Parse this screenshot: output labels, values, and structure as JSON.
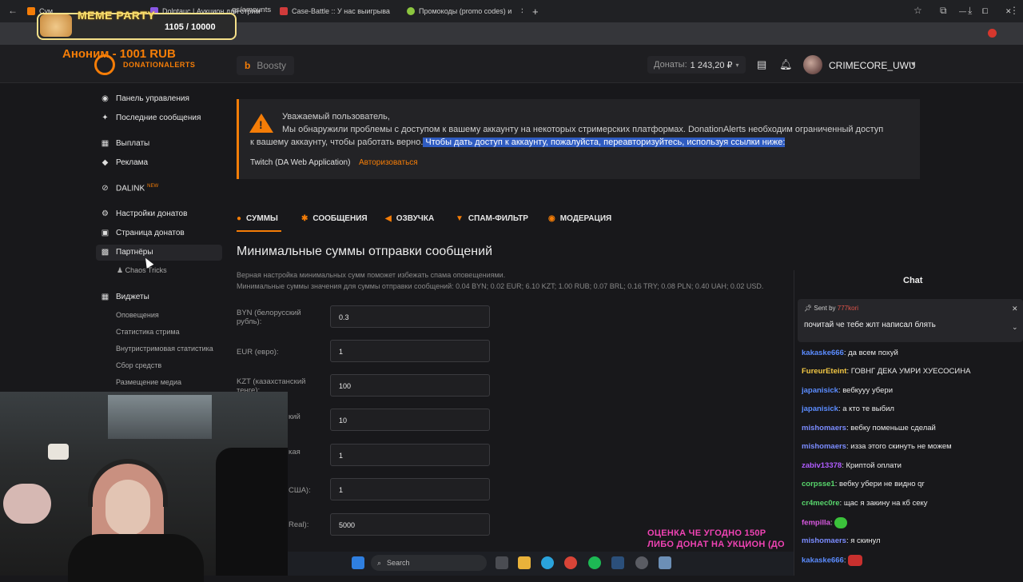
{
  "browser": {
    "tabs": [
      {
        "label": "Сум"
      },
      {
        "label": "Dolntauc | Аукцион для стрим"
      },
      {
        "label": "Case-Battle :: У нас выигрыва"
      },
      {
        "label": "Промокоды (promo codes) и"
      }
    ],
    "new_tab": "+",
    "url": "gs/amounts",
    "window_controls": {
      "minimize": "—",
      "maximize": "⧠",
      "close": "✕"
    }
  },
  "overlay": {
    "title": "MEME PARTY",
    "counter": "1105 / 10000"
  },
  "header": {
    "anon_label": "Аноним - 1001 RUB",
    "brand": "DONATIONALERTS",
    "boosty": "Boosty",
    "boosty_letter": "b",
    "donations_label": "Донаты:",
    "donations_value": "1 243,20 ₽",
    "username": "CRIMECORE_UWU"
  },
  "sidebar": {
    "items": [
      {
        "label": "Панель управления",
        "icon": "dashboard-icon"
      },
      {
        "label": "Последние сообщения",
        "icon": "messages-icon"
      },
      {
        "label": "Выплаты",
        "icon": "payouts-icon"
      },
      {
        "label": "Реклама",
        "icon": "ads-icon"
      },
      {
        "label": "DALINK",
        "icon": "dalink-icon",
        "badge": "NEW"
      },
      {
        "label": "Настройки донатов",
        "icon": "settings-icon"
      },
      {
        "label": "Страница донатов",
        "icon": "page-icon"
      },
      {
        "label": "Партнёры",
        "icon": "partners-icon"
      },
      {
        "label": "Виджеты",
        "icon": "widgets-icon"
      }
    ],
    "partner_sub": "Chaos Tricks",
    "widget_subs": [
      "Оповещения",
      "Статистика стрима",
      "Внутристримовая статистика",
      "Сбор средств",
      "Размещение медиа"
    ]
  },
  "alert": {
    "line1": "Уважаемый пользователь,",
    "line2": "Мы обнаружили проблемы с доступом к вашему аккаунту на некоторых стримерских платформах. DonationAlerts необходим ограниченный доступ",
    "line3a": "к вашему аккаунту, чтобы работать верно.",
    "line3b": " Чтобы дать доступ к аккаунту, пожалуйста, переавторизуйтесь, используя ссылки ниже:",
    "platform": "Twitch (DA Web Application)",
    "auth_link": "Авторизоваться"
  },
  "tabs": [
    {
      "label": "СУММЫ",
      "icon": "coin-icon"
    },
    {
      "label": "СООБЩЕНИЯ",
      "icon": "message-icon"
    },
    {
      "label": "ОЗВУЧКА",
      "icon": "speaker-icon"
    },
    {
      "label": "СПАМ-ФИЛЬТР",
      "icon": "filter-icon"
    },
    {
      "label": "МОДЕРАЦИЯ",
      "icon": "moderation-icon"
    }
  ],
  "main": {
    "heading": "Минимальные суммы отправки сообщений",
    "desc1": "Верная настройка минимальных сумм поможет избежать спама оповещениями.",
    "desc2": "Минимальные суммы значения для суммы отправки сообщений: 0.04 BYN; 0.02 EUR; 6.10 KZT; 1.00 RUB; 0.07 BRL; 0.16 TRY; 0.08 PLN; 0.40 UAH; 0.02 USD.",
    "fields": [
      {
        "label": "BYN (белорусский рубль):",
        "value": "0.3"
      },
      {
        "label": "EUR (евро):",
        "value": "1"
      },
      {
        "label": "KZT (казахстанский тенге):",
        "value": "100"
      },
      {
        "label": "кий",
        "value": "10"
      },
      {
        "label": "кая",
        "value": "1"
      },
      {
        "label": "США):",
        "value": "1"
      },
      {
        "label": "Real):",
        "value": "5000"
      }
    ]
  },
  "chat": {
    "title": "Chat",
    "pinned_sent_by": "Sent by",
    "pinned_user": "777kori",
    "pinned_msg": "почитай че тебе жлт написал блять",
    "messages": [
      {
        "user": "kakaske666",
        "color": "#5b8cff",
        "text": ": да всем похуй"
      },
      {
        "user": "FureurEteint",
        "color": "#f2c744",
        "text": ": ГОВНГ ДЕКА УМРИ ХУЕСОСИНА"
      },
      {
        "user": "japanisick",
        "color": "#5b8cff",
        "text": ": вебкууу убери"
      },
      {
        "user": "japanisick",
        "color": "#5b8cff",
        "text": ": а кто те выбил"
      },
      {
        "user": "mishomaers",
        "color": "#7b8cff",
        "text": ": вебку поменьше сделай"
      },
      {
        "user": "mishomaers",
        "color": "#7b8cff",
        "text": ": изза этого скинуть не можем"
      },
      {
        "user": "zabiv13378",
        "color": "#b05cff",
        "text": ": Криптой оплати"
      },
      {
        "user": "corpsse1",
        "color": "#58d66c",
        "text": ": вебку убери не видно qr"
      },
      {
        "user": "cr4mec0re",
        "color": "#58d66c",
        "text": ": щас я закину на кб секу"
      },
      {
        "user": "fempilla",
        "color": "#d858e0",
        "text": ": "
      },
      {
        "user": "mishomaers",
        "color": "#7b8cff",
        "text": ": я скинул"
      },
      {
        "user": "kakaske666",
        "color": "#5b8cff",
        "text": ": "
      }
    ]
  },
  "stream_overlay": {
    "line1": "ОЦЕНКА ЧЕ УГОДНО 150Р",
    "line2": "ЛИБО ДОНАТ НА УКЦИОН (ДО"
  },
  "taskbar": {
    "search": "Search"
  },
  "colors": {
    "accent": "#f57d07",
    "highlight": "#2f5cc2"
  }
}
